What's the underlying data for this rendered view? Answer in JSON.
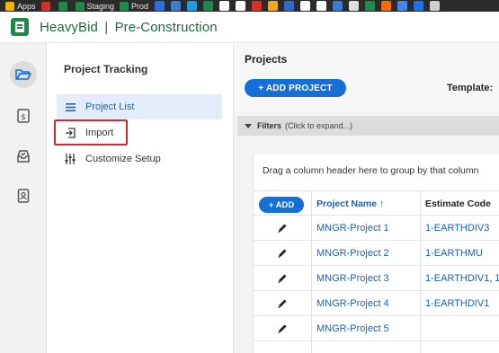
{
  "bookmarks": [
    {
      "label": "Apps",
      "icon": "apps-grid-icon",
      "color": "#f4b400"
    },
    {
      "label": "",
      "icon": "gmail-icon",
      "color": "#d93025"
    },
    {
      "label": "",
      "icon": "sheets-icon",
      "color": "#1e8a4a"
    },
    {
      "label": "Staging",
      "icon": "sheets-icon",
      "color": "#1e8a4a"
    },
    {
      "label": "Prod",
      "icon": "sheets-icon",
      "color": "#1e8a4a"
    }
  ],
  "bookmark_favicons": [
    "#2d6ee0",
    "#3a7bd5",
    "#1f9be0",
    "#1e8a4a",
    "#ffffff",
    "#ffffff",
    "#d93025",
    "#f5a623",
    "#2b6cd1",
    "#ffffff",
    "#ffffff",
    "#3a7bd5",
    "#e0e0e0",
    "#1e8a4a",
    "#ff6a00",
    "#4285f4",
    "#1a73e8",
    "#cfcfcf"
  ],
  "app": {
    "brand": "HeavyBid",
    "separator": "|",
    "module": "Pre-Construction"
  },
  "rail": [
    "folder-open-icon",
    "document-dollar-icon",
    "inbox-check-icon",
    "contacts-book-icon"
  ],
  "side_panel": {
    "title": "Project Tracking",
    "items": [
      {
        "label": "Project List",
        "icon": "list-icon",
        "active": true
      },
      {
        "label": "Import",
        "icon": "import-icon",
        "active": false
      },
      {
        "label": "Customize Setup",
        "icon": "sliders-icon",
        "active": false
      }
    ]
  },
  "main": {
    "title": "Projects",
    "add_project_label": "+ ADD PROJECT",
    "template_label": "Template:",
    "filters_label": "Filters",
    "filters_hint": "(Click to expand...)",
    "group_hint": "Drag a column header here to group by that column",
    "add_label": "+ ADD",
    "columns": {
      "name": "Project Name",
      "name_sort_icon": "↑",
      "code": "Estimate Code"
    },
    "rows": [
      {
        "name": "MNGR-Project 1",
        "code": "1-EARTHDIV3"
      },
      {
        "name": "MNGR-Project 2",
        "code": "1-EARTHMU"
      },
      {
        "name": "MNGR-Project 3",
        "code": "1-EARTHDIV1, 1"
      },
      {
        "name": "MNGR-Project 4",
        "code": "1-EARTHDIV1"
      },
      {
        "name": "MNGR-Project 5",
        "code": ""
      }
    ]
  },
  "colors": {
    "brand_green": "#1e8a4a",
    "primary_blue": "#1570d6",
    "link_blue": "#1560c0",
    "highlight_red": "#d62828"
  }
}
